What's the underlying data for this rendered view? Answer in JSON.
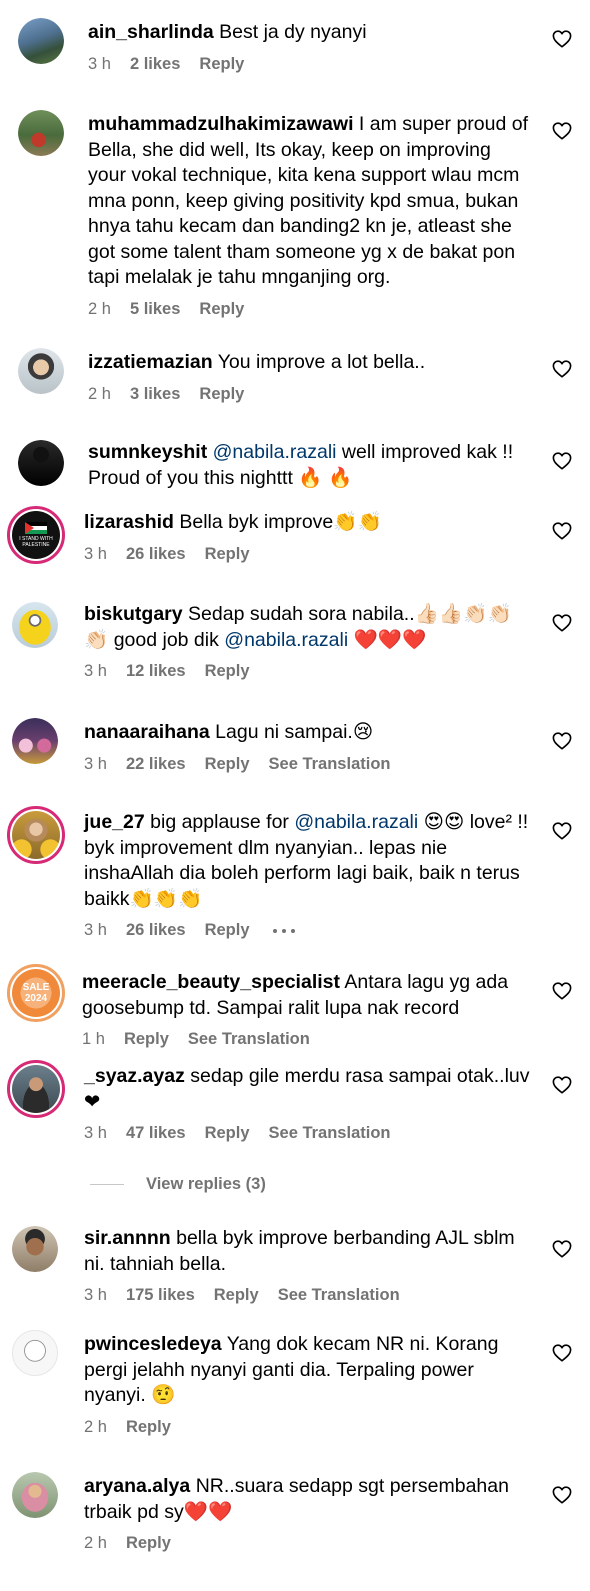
{
  "comments": [
    {
      "username": "ain_sharlinda",
      "lead": "",
      "mention": "",
      "text": "Best ja dy nyanyi",
      "time": "3 h",
      "likes": "2 likes",
      "reply": "Reply",
      "translation": ""
    },
    {
      "username": "muhammadzulhakimizawawi",
      "lead": "",
      "mention": "",
      "text": "I am super proud of Bella, she did well, Its okay, keep on improving your vokal technique, kita kena support wlau mcm mna ponn, keep giving positivity kpd smua, bukan hnya tahu kecam dan banding2 kn je, atleast she got some talent tham someone yg x de bakat pon tapi melalak je tahu mnganjing org.",
      "time": "2 h",
      "likes": "5 likes",
      "reply": "Reply",
      "translation": ""
    },
    {
      "username": "izzatiemazian",
      "lead": "",
      "mention": "",
      "text": "You improve a lot bella..",
      "time": "2 h",
      "likes": "3 likes",
      "reply": "Reply",
      "translation": ""
    },
    {
      "username": "sumnkeyshit",
      "lead": "",
      "mention": "@nabila.razali",
      "text": "well improved kak !! Proud of you this nighttt 🔥 🔥",
      "time": "",
      "likes": "",
      "reply": "",
      "translation": ""
    },
    {
      "username": "lizarashid",
      "lead": "",
      "mention": "",
      "text": "Bella byk improve👏👏",
      "time": "3 h",
      "likes": "26 likes",
      "reply": "Reply",
      "translation": "",
      "avatar_text": "I STAND WITH PALESTINE"
    },
    {
      "username": "biskutgary",
      "lead": "Sedap sudah sora nabila..👍🏻👍🏻👏🏻👏🏻👏🏻 good job dik",
      "mention": "@nabila.razali",
      "text": "❤️❤️❤️",
      "time": "3 h",
      "likes": "12 likes",
      "reply": "Reply",
      "translation": ""
    },
    {
      "username": "nanaaraihana",
      "lead": "",
      "mention": "",
      "text": "Lagu ni sampai.😢",
      "time": "3 h",
      "likes": "22 likes",
      "reply": "Reply",
      "translation": "See Translation"
    },
    {
      "username": "jue_27",
      "lead": "big applause for",
      "mention": "@nabila.razali",
      "text": "😍😍 love² !! byk improvement dlm nyanyian.. lepas nie inshaAllah dia boleh perform lagi baik, baik n terus baikk👏👏👏",
      "time": "3 h",
      "likes": "26 likes",
      "reply": "Reply",
      "translation": ""
    },
    {
      "username": "meeracle_beauty_specialist",
      "lead": "",
      "mention": "",
      "text": "Antara lagu yg ada goosebump td. Sampai ralit lupa nak record",
      "time": "1 h",
      "likes": "",
      "reply": "Reply",
      "translation": "See Translation",
      "avatar_text": "SALE 2024"
    },
    {
      "username": "_syaz.ayaz",
      "lead": "",
      "mention": "",
      "text": "sedap gile merdu rasa sampai otak..luv❤",
      "time": "3 h",
      "likes": "47 likes",
      "reply": "Reply",
      "translation": "See Translation"
    },
    {
      "username": "sir.annnn",
      "lead": "",
      "mention": "",
      "text": "bella byk improve berbanding AJL sblm ni. tahniah bella.",
      "time": "3 h",
      "likes": "175 likes",
      "reply": "Reply",
      "translation": "See Translation"
    },
    {
      "username": "pwincesledeya",
      "lead": "",
      "mention": "",
      "text": "Yang dok kecam NR ni. Korang pergi jelahh nyanyi ganti dia. Terpaling power nyanyi. 🤨",
      "time": "2 h",
      "likes": "",
      "reply": "Reply",
      "translation": ""
    },
    {
      "username": "aryana.alya",
      "lead": "",
      "mention": "",
      "text": "NR..suara sedapp sgt persembahan trbaik pd sy❤️❤️",
      "time": "2 h",
      "likes": "",
      "reply": "Reply",
      "translation": ""
    }
  ],
  "view_replies": "View replies (3)",
  "colors": {
    "secondary_text": "#737373",
    "mention": "#00376b",
    "story_ring": "#d62976"
  }
}
